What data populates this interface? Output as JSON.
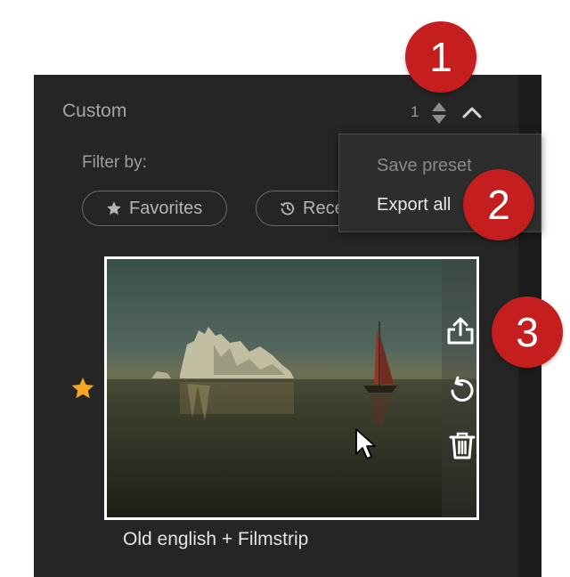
{
  "header": {
    "title": "Custom",
    "count": "1"
  },
  "filter": {
    "label": "Filter by:",
    "chips": [
      {
        "label": "Favorites",
        "icon": "star-icon"
      },
      {
        "label": "Recent",
        "icon": "history-icon"
      }
    ]
  },
  "menu": {
    "items": [
      {
        "label": "Save preset",
        "state": "disabled"
      },
      {
        "label": "Export all",
        "state": "enabled"
      }
    ]
  },
  "preset": {
    "name": "Old english + Filmstrip",
    "favorite": true,
    "actions": [
      "export-icon",
      "reset-icon",
      "trash-icon"
    ]
  },
  "callouts": [
    "1",
    "2",
    "3"
  ],
  "colors": {
    "panel": "#252525",
    "callout": "#c41e1e",
    "favorite_star": "#f5a623",
    "selection_border": "#ffffff"
  }
}
